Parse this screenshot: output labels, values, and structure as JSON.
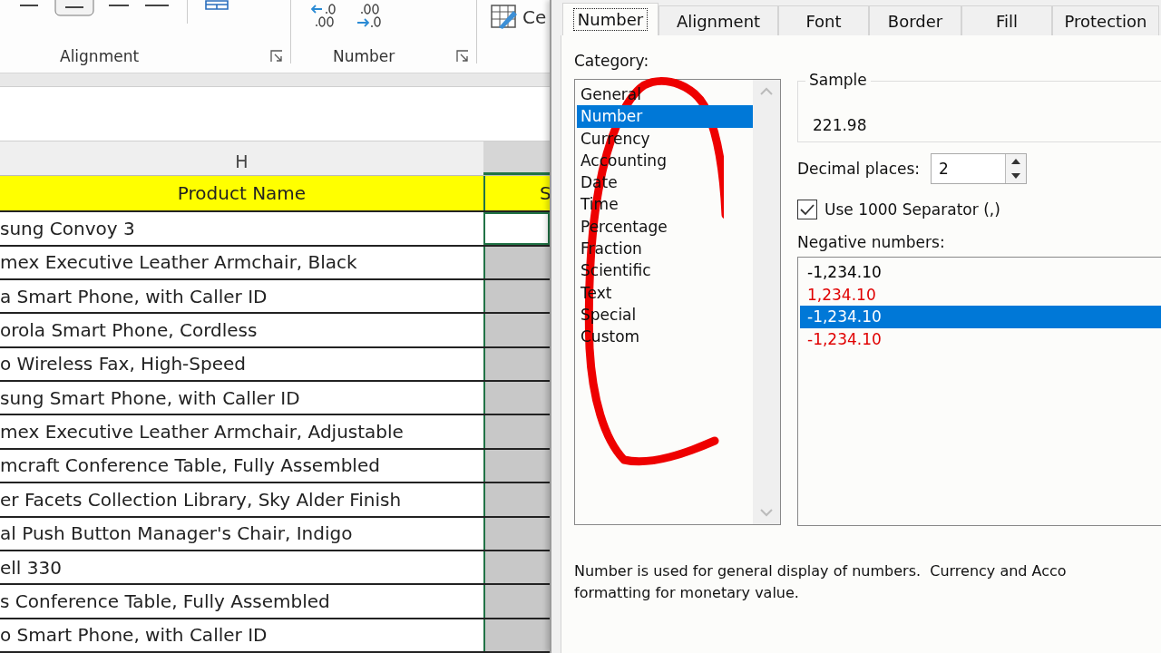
{
  "ribbon": {
    "groups": [
      {
        "label": "Alignment"
      },
      {
        "label": "Number"
      }
    ],
    "cell_styles_label": "Ce"
  },
  "sheet": {
    "columns": [
      {
        "label": "H",
        "selected": false
      },
      {
        "selected": true
      }
    ],
    "header": [
      "Product Name",
      "S"
    ],
    "rows": [
      {
        "product_name": "sung Convoy 3",
        "selected": true,
        "active": true
      },
      {
        "product_name": "mex Executive Leather Armchair, Black",
        "selected": true,
        "active": false
      },
      {
        "product_name": "a Smart Phone, with Caller ID",
        "selected": true,
        "active": false
      },
      {
        "product_name": "orola Smart Phone, Cordless",
        "selected": true,
        "active": false
      },
      {
        "product_name": "o Wireless Fax, High-Speed",
        "selected": true,
        "active": false
      },
      {
        "product_name": "sung Smart Phone, with Caller ID",
        "selected": true,
        "active": false
      },
      {
        "product_name": "mex Executive Leather Armchair, Adjustable",
        "selected": true,
        "active": false
      },
      {
        "product_name": "mcraft Conference Table, Fully Assembled",
        "selected": true,
        "active": false
      },
      {
        "product_name": "er Facets Collection Library, Sky Alder Finish",
        "selected": true,
        "active": false
      },
      {
        "product_name": "al Push Button Manager's Chair, Indigo",
        "selected": true,
        "active": false
      },
      {
        "product_name": "ell 330",
        "selected": true,
        "active": false
      },
      {
        "product_name": "s Conference Table, Fully Assembled",
        "selected": true,
        "active": false
      },
      {
        "product_name": "o Smart Phone, with Caller ID",
        "selected": true,
        "active": false
      }
    ]
  },
  "dialog": {
    "tabs": [
      {
        "label": "Number",
        "selected": true
      },
      {
        "label": "Alignment",
        "selected": false
      },
      {
        "label": "Font",
        "selected": false
      },
      {
        "label": "Border",
        "selected": false
      },
      {
        "label": "Fill",
        "selected": false
      },
      {
        "label": "Protection",
        "selected": false
      }
    ],
    "category_label": "Category:",
    "categories": [
      {
        "label": "General",
        "selected": false
      },
      {
        "label": "Number",
        "selected": true
      },
      {
        "label": "Currency",
        "selected": false
      },
      {
        "label": "Accounting",
        "selected": false
      },
      {
        "label": "Date",
        "selected": false
      },
      {
        "label": "Time",
        "selected": false
      },
      {
        "label": "Percentage",
        "selected": false
      },
      {
        "label": "Fraction",
        "selected": false
      },
      {
        "label": "Scientific",
        "selected": false
      },
      {
        "label": "Text",
        "selected": false
      },
      {
        "label": "Special",
        "selected": false
      },
      {
        "label": "Custom",
        "selected": false
      }
    ],
    "sample": {
      "label": "Sample",
      "value": "221.98"
    },
    "decimal_places": {
      "label": "Decimal places:",
      "value": "2"
    },
    "separator": {
      "label": "Use 1000 Separator (,)",
      "checked": true
    },
    "negative_label": "Negative numbers:",
    "negative_numbers": [
      {
        "text": "-1,234.10",
        "color": "#000000",
        "selected": false
      },
      {
        "text": "1,234.10",
        "color": "#e00000",
        "selected": false
      },
      {
        "text": "-1,234.10",
        "selected": true
      },
      {
        "text": "-1,234.10",
        "color": "#e00000",
        "selected": false
      }
    ],
    "description": "Number is used for general display of numbers.  Currency and Acco\nformatting for monetary value."
  }
}
